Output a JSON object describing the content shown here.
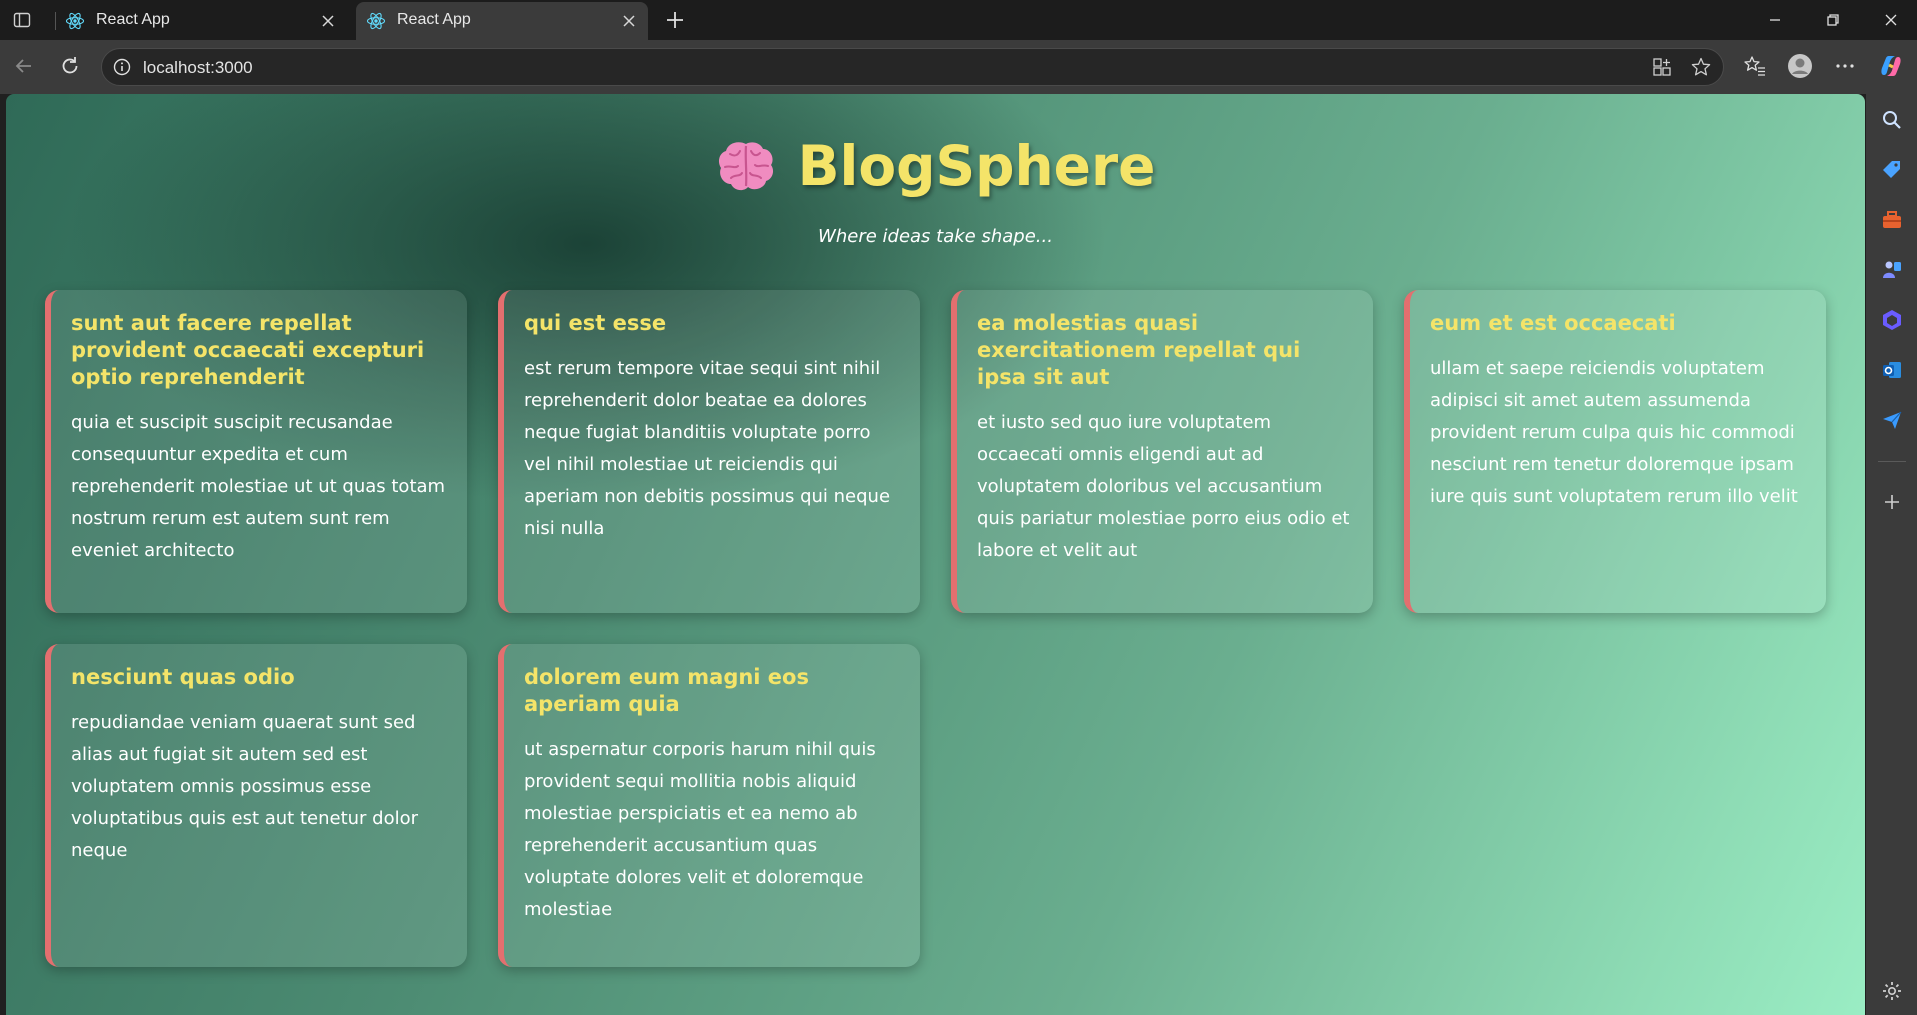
{
  "browser": {
    "tabs": [
      {
        "title": "React App",
        "active": false
      },
      {
        "title": "React App",
        "active": true
      }
    ],
    "url": "localhost:3000"
  },
  "site": {
    "title": "BlogSphere",
    "tagline": "Where ideas take shape..."
  },
  "posts": [
    {
      "title": "sunt aut facere repellat provident occaecati excepturi optio reprehenderit",
      "body": "quia et suscipit suscipit recusandae consequuntur expedita et cum reprehenderit molestiae ut ut quas totam nostrum rerum est autem sunt rem eveniet architecto"
    },
    {
      "title": "qui est esse",
      "body": "est rerum tempore vitae sequi sint nihil reprehenderit dolor beatae ea dolores neque fugiat blanditiis voluptate porro vel nihil molestiae ut reiciendis qui aperiam non debitis possimus qui neque nisi nulla"
    },
    {
      "title": "ea molestias quasi exercitationem repellat qui ipsa sit aut",
      "body": "et iusto sed quo iure voluptatem occaecati omnis eligendi aut ad voluptatem doloribus vel accusantium quis pariatur molestiae porro eius odio et labore et velit aut"
    },
    {
      "title": "eum et est occaecati",
      "body": "ullam et saepe reiciendis voluptatem adipisci sit amet autem assumenda provident rerum culpa quis hic commodi nesciunt rem tenetur doloremque ipsam iure quis sunt voluptatem rerum illo velit"
    },
    {
      "title": "nesciunt quas odio",
      "body": "repudiandae veniam quaerat sunt sed alias aut fugiat sit autem sed est voluptatem omnis possimus esse voluptatibus quis est aut tenetur dolor neque"
    },
    {
      "title": "dolorem eum magni eos aperiam quia",
      "body": "ut aspernatur corporis harum nihil quis provident sequi mollitia nobis aliquid molestiae perspiciatis et ea nemo ab reprehenderit accusantium quas voluptate dolores velit et doloremque molestiae"
    }
  ],
  "colors": {
    "card_title": "#f4e469",
    "card_accent": "#e36f6f",
    "site_title": "#f4e469"
  }
}
